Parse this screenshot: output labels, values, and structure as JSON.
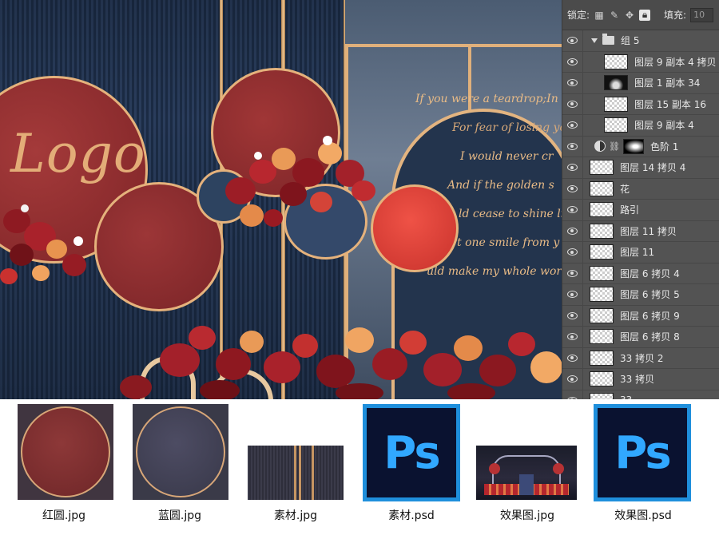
{
  "canvas": {
    "logo_text": "Logo",
    "script_lines": [
      "If you were a teardrop;In",
      "For fear of losing yo",
      "I would never cr",
      "And if the golden s",
      "ld cease to shine li",
      "t one smile from y",
      "uld make my whole wor"
    ]
  },
  "layers_panel": {
    "lock_label": "锁定:",
    "fill_label": "填充:",
    "fill_value": "10",
    "layers": [
      {
        "name": "组 5",
        "kind": "group"
      },
      {
        "name": "图层 9 副本 4 拷贝",
        "kind": "layer",
        "indent": true
      },
      {
        "name": "图层 1 副本 34",
        "kind": "layer",
        "indent": true,
        "thumb": "dark"
      },
      {
        "name": "图层 15 副本 16",
        "kind": "layer",
        "indent": true
      },
      {
        "name": "图层 9 副本 4",
        "kind": "layer",
        "indent": true
      },
      {
        "name": "色阶 1",
        "kind": "adjustment"
      },
      {
        "name": "图层 14 拷贝 4",
        "kind": "layer"
      },
      {
        "name": "花",
        "kind": "layer"
      },
      {
        "name": "路引",
        "kind": "layer"
      },
      {
        "name": "图层 11 拷贝",
        "kind": "layer"
      },
      {
        "name": "图层 11",
        "kind": "layer"
      },
      {
        "name": "图层 6 拷贝 4",
        "kind": "layer"
      },
      {
        "name": "图层 6 拷贝 5",
        "kind": "layer"
      },
      {
        "name": "图层 6 拷贝 9",
        "kind": "layer"
      },
      {
        "name": "图层 6 拷贝 8",
        "kind": "layer"
      },
      {
        "name": "33 拷贝 2",
        "kind": "layer"
      },
      {
        "name": "33 拷贝",
        "kind": "layer"
      },
      {
        "name": "33",
        "kind": "layer"
      }
    ]
  },
  "files": [
    {
      "label": "红圆.jpg",
      "type": "red-circle"
    },
    {
      "label": "蓝圆.jpg",
      "type": "blue-circle"
    },
    {
      "label": "素材.jpg",
      "type": "material"
    },
    {
      "label": "素材.psd",
      "type": "psd"
    },
    {
      "label": "效果图.jpg",
      "type": "render"
    },
    {
      "label": "效果图.psd",
      "type": "psd"
    }
  ],
  "ps_icon_text": "Ps",
  "colors": {
    "wall_navy": "#22344f",
    "gold": "#e3b480",
    "disc_red": "#9c3637",
    "disc_coral": "#ef5246",
    "ps_blue": "#31a8ff",
    "ps_dark": "#0a1230",
    "panel_gray": "#535353"
  },
  "icons": [
    "eye-icon",
    "folder-icon",
    "lock-icon",
    "brush-icon",
    "move-icon",
    "transparency-lock-icon",
    "levels-adjustment-icon",
    "chain-link-icon"
  ]
}
